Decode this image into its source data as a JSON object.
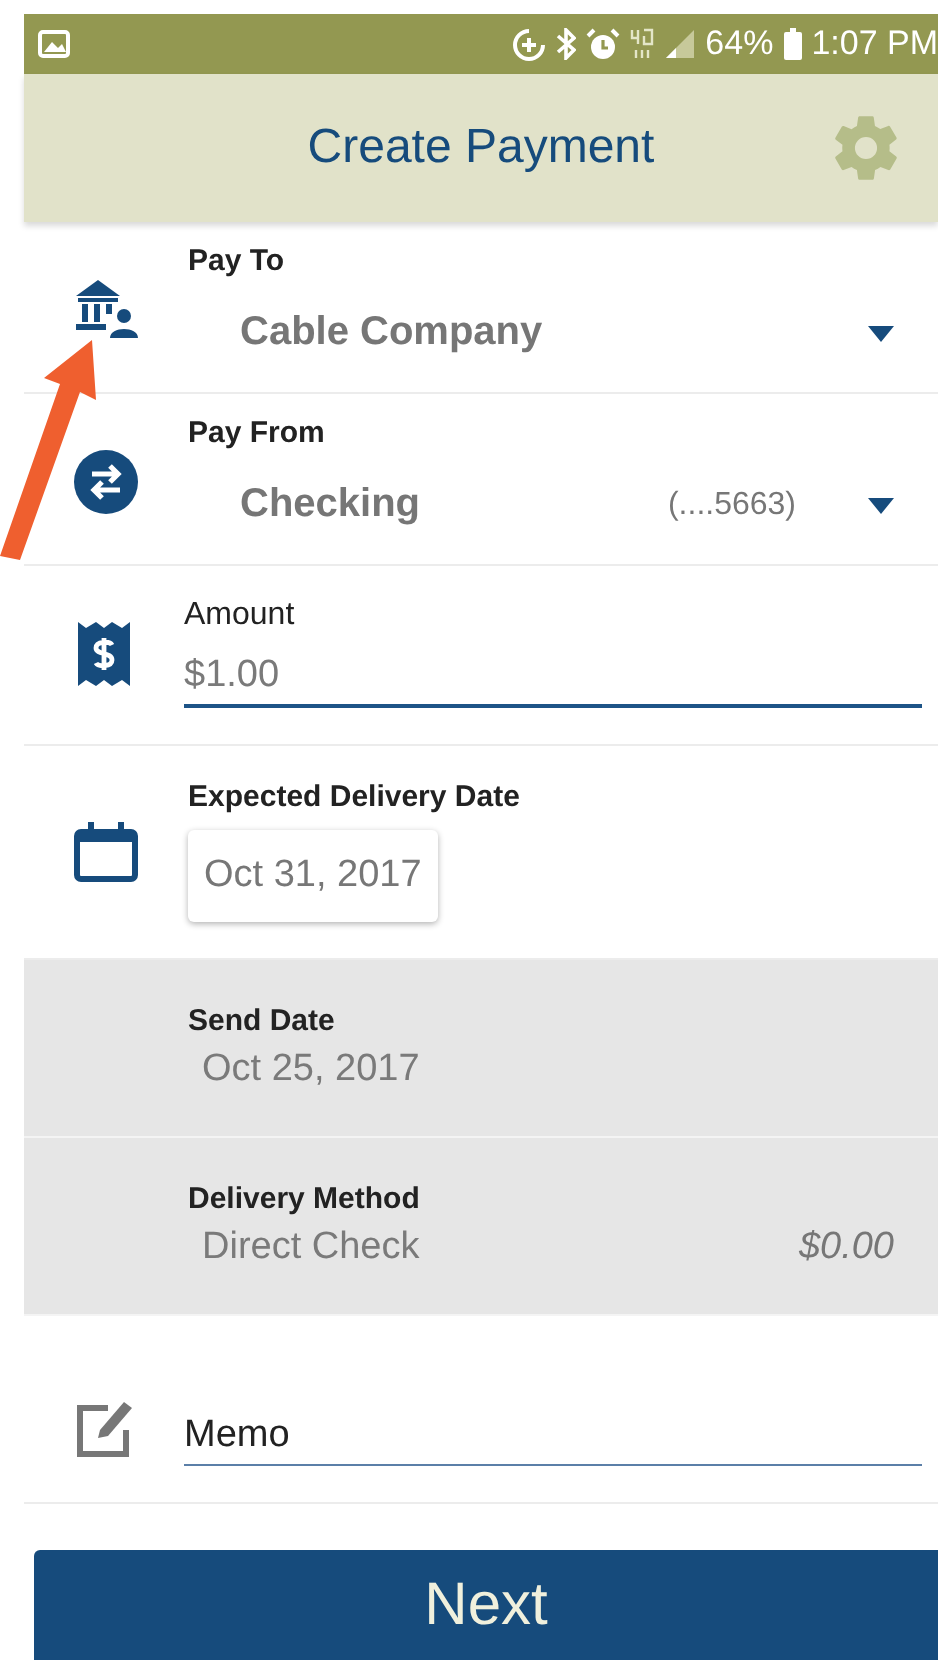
{
  "status_bar": {
    "battery": "64%",
    "time": "1:07 PM"
  },
  "header": {
    "title": "Create Payment"
  },
  "fields": [
    {
      "kind": "dropdown",
      "label": "Pay To",
      "value": "Cable Company"
    },
    {
      "kind": "dropdown",
      "label": "Pay From",
      "value": "Checking",
      "detail": "(....5663)"
    },
    {
      "kind": "input",
      "label": "Amount",
      "value": "$1.00"
    },
    {
      "kind": "date",
      "label": "Expected Delivery Date",
      "value": "Oct 31, 2017"
    },
    {
      "kind": "info",
      "label": "Send Date",
      "value": "Oct 25, 2017"
    },
    {
      "kind": "info",
      "label": "Delivery Method",
      "value": "Direct Check",
      "detail": "$0.00"
    },
    {
      "kind": "memo",
      "placeholder": "Memo"
    }
  ],
  "next_button": "Next"
}
